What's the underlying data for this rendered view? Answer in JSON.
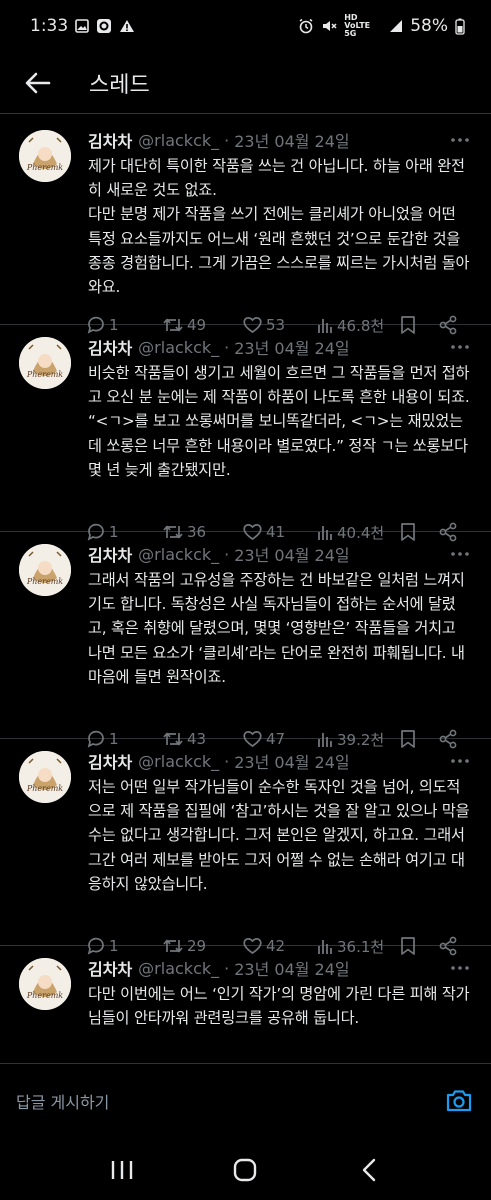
{
  "status": {
    "time": "1:33",
    "network": "HD VoLTE 5G",
    "battery": "58%"
  },
  "header": {
    "title": "스레드"
  },
  "tweets": [
    {
      "name": "김차차",
      "handle": "@rlackck_",
      "date": "23년 04월 24일",
      "text": "제가 대단히 특이한 작품을 쓰는 건 아닙니다. 하늘 아래 완전히 새로운 것도 없죠.\n다만 분명 제가 작품을 쓰기 전에는 클리셰가 아니었을 어떤 특정 요소들까지도 어느새 ‘원래 흔했던 것’으로 둔갑한 것을 종종 경험합니다. 그게 가끔은 스스로를 찌르는 가시처럼 돌아와요.",
      "replies": "1",
      "retweets": "49",
      "likes": "53",
      "views": "46.8천"
    },
    {
      "name": "김차차",
      "handle": "@rlackck_",
      "date": "23년 04월 24일",
      "text": "비슷한 작품들이 생기고 세월이 흐르면 그 작품들을 먼저 접하고 오신 분 눈에는 제 작품이 하품이 나도록 흔한 내용이 되죠. “<ㄱ>를 보고 쏘롱써머를 보니똑같더라, <ㄱ>는 재밌었는데 쏘롱은 너무 흔한 내용이라 별로였다.” 정작 ㄱ는 쏘롱보다 몇 년 늦게 출간됐지만.",
      "replies": "1",
      "retweets": "36",
      "likes": "41",
      "views": "40.4천"
    },
    {
      "name": "김차차",
      "handle": "@rlackck_",
      "date": "23년 04월 24일",
      "text": "그래서 작품의 고유성을 주장하는 건 바보같은 일처럼 느껴지기도 합니다. 독창성은 사실 독자님들이 접하는 순서에 달렸고, 혹은 취향에 달렸으며, 몇몇 ‘영향받은’ 작품들을 거치고 나면 모든 요소가 ‘클리셰’라는 단어로 완전히 파훼됩니다. 내 마음에 들면 원작이죠.",
      "replies": "1",
      "retweets": "43",
      "likes": "47",
      "views": "39.2천"
    },
    {
      "name": "김차차",
      "handle": "@rlackck_",
      "date": "23년 04월 24일",
      "text": "저는 어떤 일부 작가님들이 순수한 독자인 것을 넘어, 의도적으로 제 작품을 집필에 ‘참고’하시는 것을 잘 알고 있으나 막을 수는 없다고 생각합니다. 그저 본인은 알겠지, 하고요. 그래서 그간 여러 제보를 받아도 그저 어쩔 수 없는 손해라 여기고 대응하지 않았습니다.",
      "replies": "1",
      "retweets": "29",
      "likes": "42",
      "views": "36.1천"
    },
    {
      "name": "김차차",
      "handle": "@rlackck_",
      "date": "23년 04월 24일",
      "text": "다만 이번에는 어느 ‘인기 작가’의 명암에 가린 다른 피해 작가님들이 안타까워 관련링크를 공유해 둡니다."
    }
  ],
  "reply_bar": {
    "placeholder": "답글 게시하기"
  },
  "colors": {
    "accent": "#1d9bf0",
    "muted": "#71767b",
    "divider": "#2f3336",
    "background": "#000000"
  }
}
